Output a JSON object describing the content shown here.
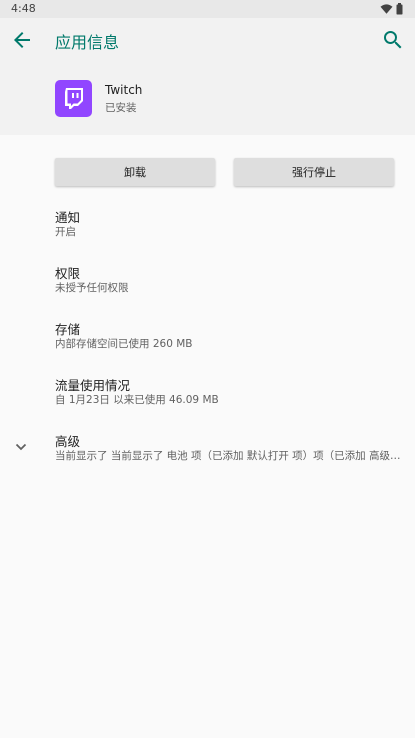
{
  "status_bar": {
    "time": "4:48"
  },
  "app_bar": {
    "title": "应用信息"
  },
  "app": {
    "name": "Twitch",
    "status": "已安装"
  },
  "buttons": {
    "uninstall": "卸载",
    "force_stop": "强行停止"
  },
  "prefs": [
    {
      "title": "通知",
      "summary": "开启"
    },
    {
      "title": "权限",
      "summary": "未授予任何权限"
    },
    {
      "title": "存储",
      "summary": "内部存储空间已使用 260 MB"
    },
    {
      "title": "流量使用情况",
      "summary": "自 1月23日 以来已使用 46.09 MB"
    },
    {
      "title": "高级",
      "summary": "当前显示了 当前显示了 电池 项（已添加 默认打开 项）项（已添加 高级…"
    }
  ],
  "colors": {
    "accent": "#00796b",
    "brand": "#9146ff"
  },
  "icons": {
    "back": "arrow-back-icon",
    "search": "search-icon",
    "wifi": "wifi-icon",
    "battery": "battery-icon",
    "expand": "chevron-down-icon",
    "app": "twitch-logo-icon"
  }
}
